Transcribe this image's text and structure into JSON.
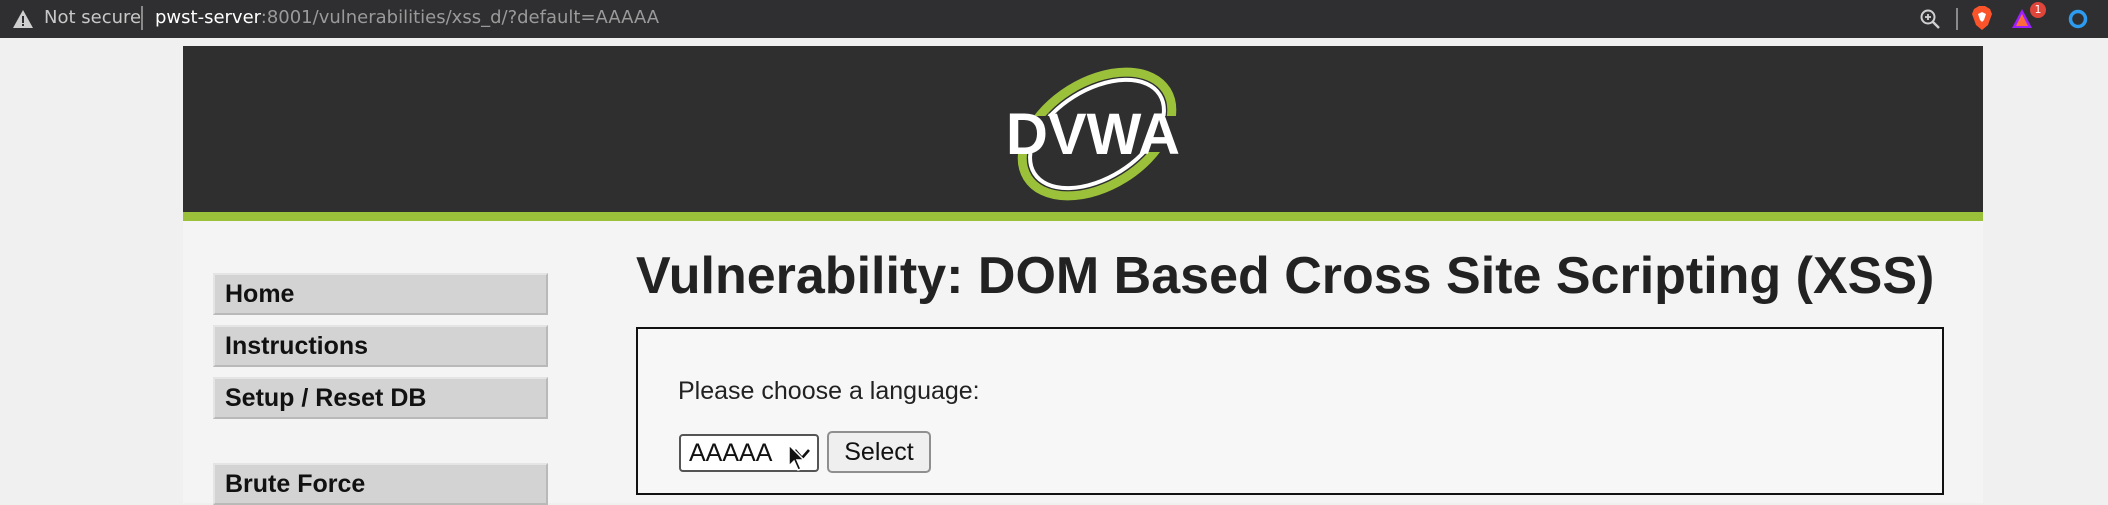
{
  "browser": {
    "security_label": "Not secure",
    "url_host": "pwst-server",
    "url_rest": ":8001/vulnerabilities/xss_d/?default=AAAAA",
    "extension_badge": "1"
  },
  "header": {
    "logo_text": "DVWA"
  },
  "menu": {
    "items": [
      "Home",
      "Instructions",
      "Setup / Reset DB",
      "Brute Force"
    ]
  },
  "main": {
    "title": "Vulnerability: DOM Based Cross Site Scripting (XSS)",
    "prompt": "Please choose a language:",
    "language_selected": "AAAAA",
    "select_button": "Select"
  },
  "colors": {
    "header_bg": "#2f2f2f",
    "accent_green": "#9bc13b",
    "addressbar_bg": "#2f2f31"
  }
}
